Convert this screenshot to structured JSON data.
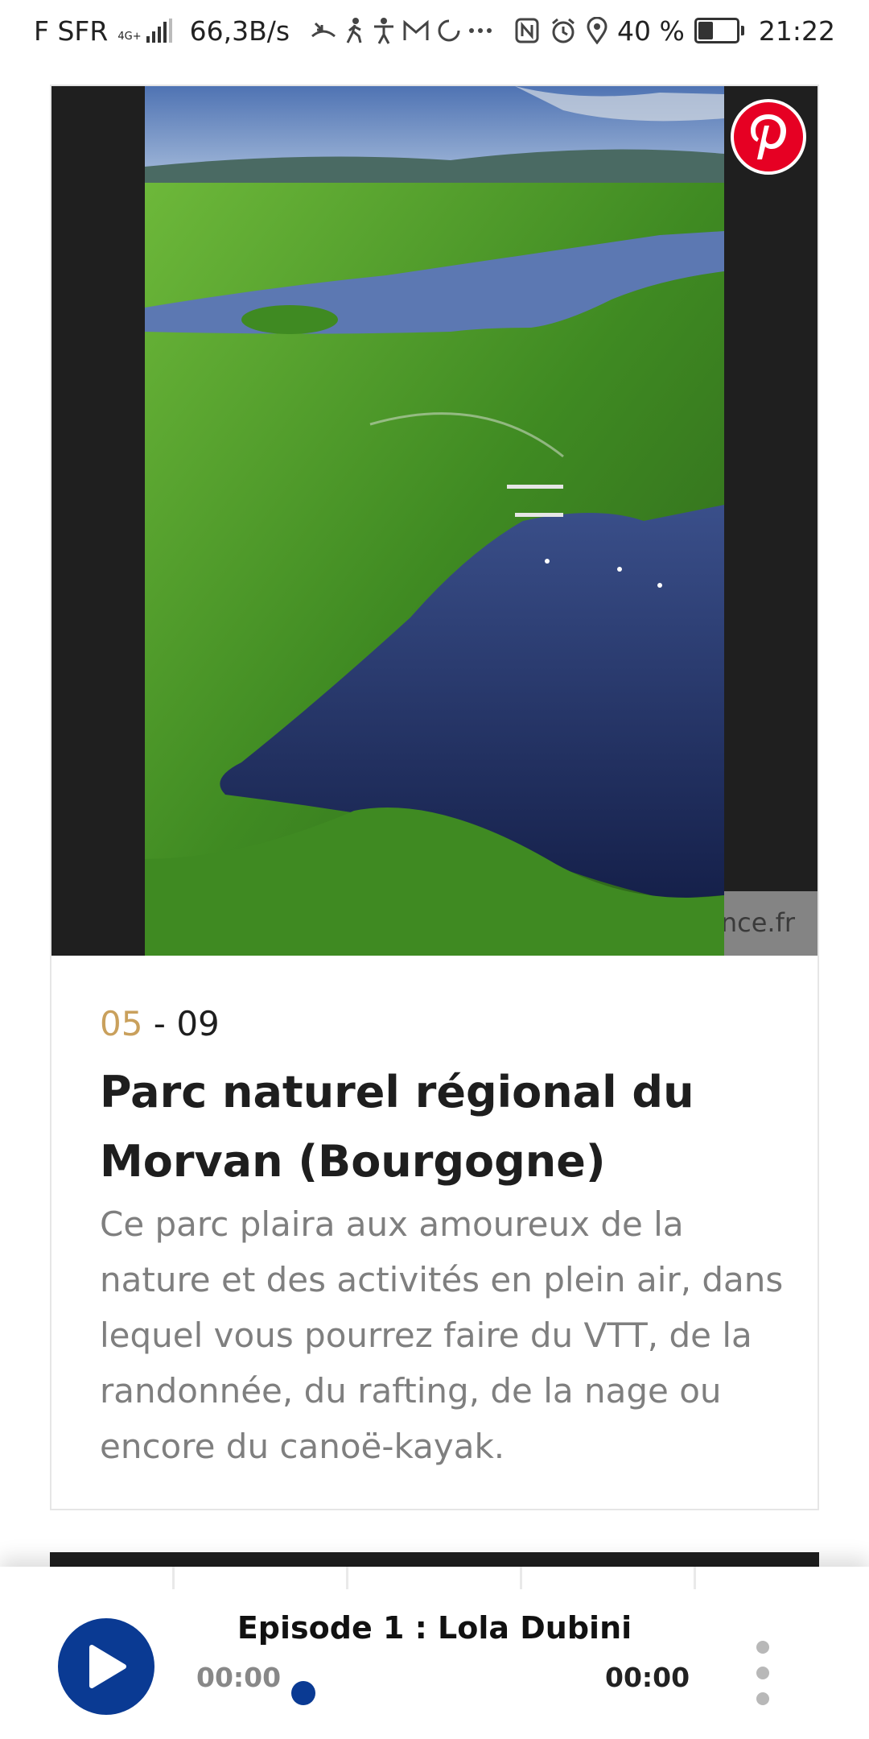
{
  "status_bar": {
    "carrier": "F SFR",
    "network_type": "4G+",
    "speed": "66,3B/s",
    "notification_icons": [
      "missed-call-icon",
      "walking-icon",
      "accessibility-icon",
      "gmail-icon",
      "sync-icon",
      "more-icon"
    ],
    "system_icons": [
      "nfc-icon",
      "alarm-icon",
      "location-icon"
    ],
    "battery_text": "40 %",
    "battery_level": 0.4,
    "time": "21:22"
  },
  "card": {
    "image_credit": "nce.fr",
    "counter_current": "05",
    "counter_separator": " - ",
    "counter_total": "09",
    "title": "Parc naturel régional du Morvan (Bourgogne)",
    "description": "Ce parc plaira aux amoureux de la nature et des activités en plein air, dans lequel vous pourrez faire du VTT, de la randonnée, du rafting, de la nage ou encore du canoë-kayak.",
    "pinterest_icon": "pinterest-icon"
  },
  "player": {
    "episode_title": "Episode 1 : Lola Dubini",
    "current_time": "00:00",
    "duration": "00:00",
    "progress": 0,
    "play_icon": "play-icon",
    "more_icon": "more-vertical-icon"
  },
  "colors": {
    "accent_gold": "#c9a05c",
    "player_blue": "#0a3a93",
    "pinterest_red": "#e60023"
  }
}
